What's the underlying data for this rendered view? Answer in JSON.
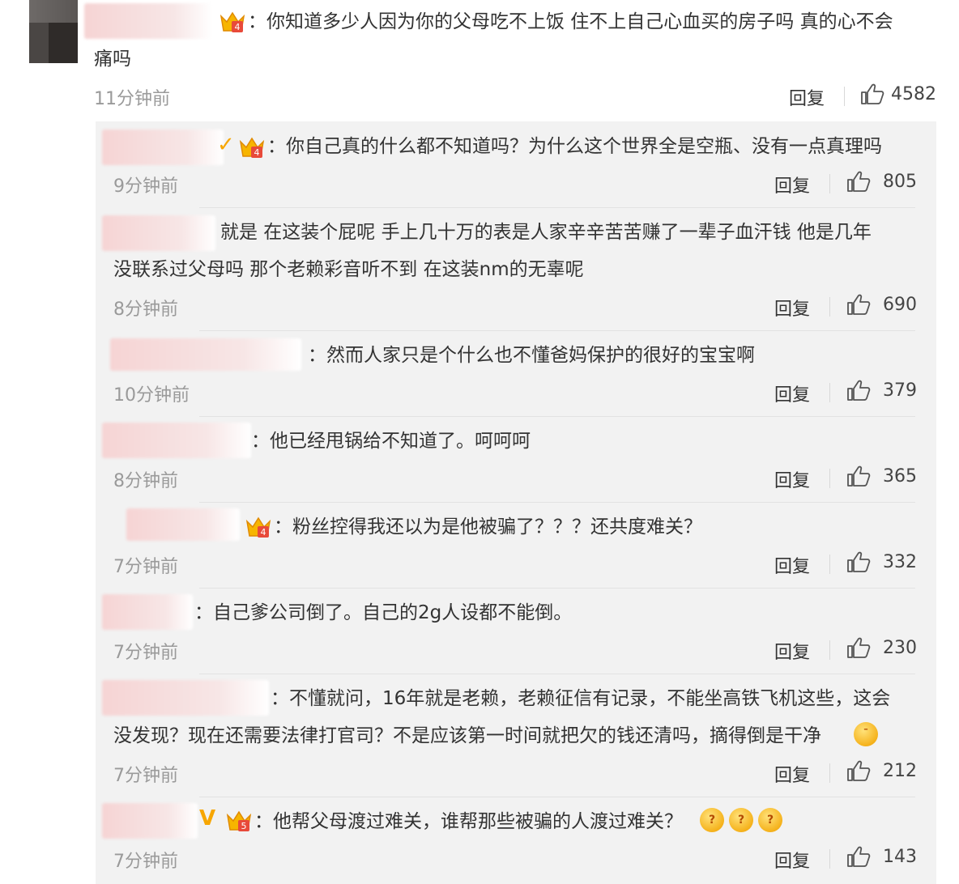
{
  "main_comment": {
    "text_line1": "：你知道多少人因为你的父母吃不上饭 住不上自己心血买的房子吗 真的心不会",
    "text_line2": "痛吗",
    "time": "11分钟前",
    "reply_label": "回复",
    "likes": "4582"
  },
  "replies": [
    {
      "line1": "：你自己真的什么都不知道吗？为什么这个世界全是空瓶、没有一点真理吗",
      "line2": "",
      "time": "9分钟前",
      "reply_label": "回复",
      "likes": "805"
    },
    {
      "line1": "就是 在这装个屁呢 手上几十万的表是人家辛辛苦苦赚了一辈子血汗钱 他是几年",
      "line2": "没联系过父母吗 那个老赖彩音听不到 在这装nm的无辜呢",
      "time": "8分钟前",
      "reply_label": "回复",
      "likes": "690"
    },
    {
      "line1": "：然而人家只是个什么也不懂爸妈保护的很好的宝宝啊",
      "line2": "",
      "time": "10分钟前",
      "reply_label": "回复",
      "likes": "379"
    },
    {
      "line1": "：他已经甩锅给不知道了。呵呵呵",
      "line2": "",
      "time": "8分钟前",
      "reply_label": "回复",
      "likes": "365"
    },
    {
      "line1": "：粉丝控得我还以为是他被骗了？？？还共度难关？",
      "line2": "",
      "time": "7分钟前",
      "reply_label": "回复",
      "likes": "332"
    },
    {
      "line1": "：自己爹公司倒了。自己的2g人设都不能倒。",
      "line2": "",
      "time": "7分钟前",
      "reply_label": "回复",
      "likes": "230"
    },
    {
      "line1": "：不懂就问，16年就是老赖，老赖征信有记录，不能坐高铁飞机这些，这会",
      "line2": "没发现？现在还需要法律打官司？不是应该第一时间就把欠的钱还清吗，摘得倒是干净",
      "time": "7分钟前",
      "reply_label": "回复",
      "likes": "212"
    },
    {
      "line1": "：他帮父母渡过难关，谁帮那些被骗的人渡过难关？",
      "line2": "",
      "time": "7分钟前",
      "reply_label": "回复",
      "likes": "143"
    }
  ],
  "badges": {
    "vip_mark": "V",
    "level_a": "4",
    "level_b": "5",
    "emoji_q": "?"
  },
  "colors": {
    "panel": "#f2f2f2",
    "accent": "#f7a600",
    "text": "#333333",
    "muted": "#9a9a9a"
  },
  "icons": [
    "thumbs-up-icon",
    "crown-badge-icon",
    "v-verified-icon",
    "shrug-emoji-icon",
    "confused-emoji-icon"
  ]
}
